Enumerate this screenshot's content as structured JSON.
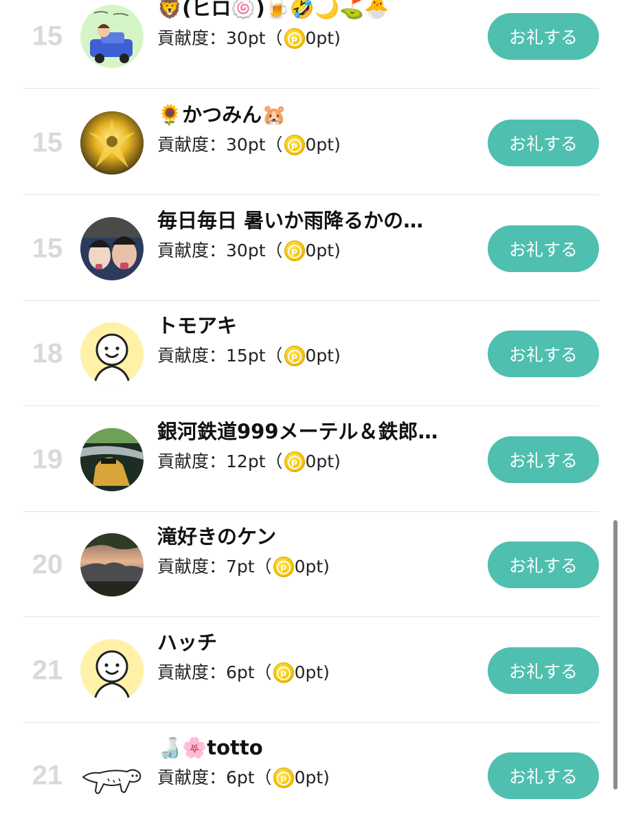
{
  "button_label": "お礼する",
  "score_prefix": "貢献度：",
  "rows": [
    {
      "rank": "15",
      "name": "🦁(ヒロ🍥)🍺🤣🌙⛳🐣",
      "pt": "30pt",
      "paren_open": "（",
      "coin_pt": "0pt)",
      "avatar": "drawing-car"
    },
    {
      "rank": "15",
      "name": "🌻かつみん🐹",
      "pt": "30pt",
      "paren_open": "（",
      "coin_pt": "0pt)",
      "avatar": "gold-armor"
    },
    {
      "rank": "15",
      "name": "毎日毎日 暑いか雨降るかの…",
      "pt": "30pt",
      "paren_open": "（",
      "coin_pt": "0pt)",
      "avatar": "two-faces"
    },
    {
      "rank": "18",
      "name": "トモアキ",
      "pt": "15pt",
      "paren_open": "（",
      "coin_pt": "0pt)",
      "avatar": "default-face"
    },
    {
      "rank": "19",
      "name": "銀河鉄道999メーテル＆鉄郎…",
      "pt": "12pt",
      "paren_open": "（",
      "coin_pt": "0pt)",
      "avatar": "anime-scene"
    },
    {
      "rank": "20",
      "name": "滝好きのケン",
      "pt": "7pt",
      "paren_open": "（",
      "coin_pt": "0pt)",
      "avatar": "sunset-landscape"
    },
    {
      "rank": "21",
      "name": "ハッチ",
      "pt": "6pt",
      "paren_open": "（",
      "coin_pt": "0pt)",
      "avatar": "default-face"
    },
    {
      "rank": "21",
      "name": "🍶🌸totto",
      "pt": "6pt",
      "paren_open": "（",
      "coin_pt": "0pt)",
      "avatar": "sketch-animal"
    }
  ],
  "coin_letter": "P",
  "colors": {
    "button": "#4fbfaf",
    "rank": "#d9d9d9",
    "coin": "#f6c400",
    "default_avatar_bg": "#fff1a8"
  }
}
